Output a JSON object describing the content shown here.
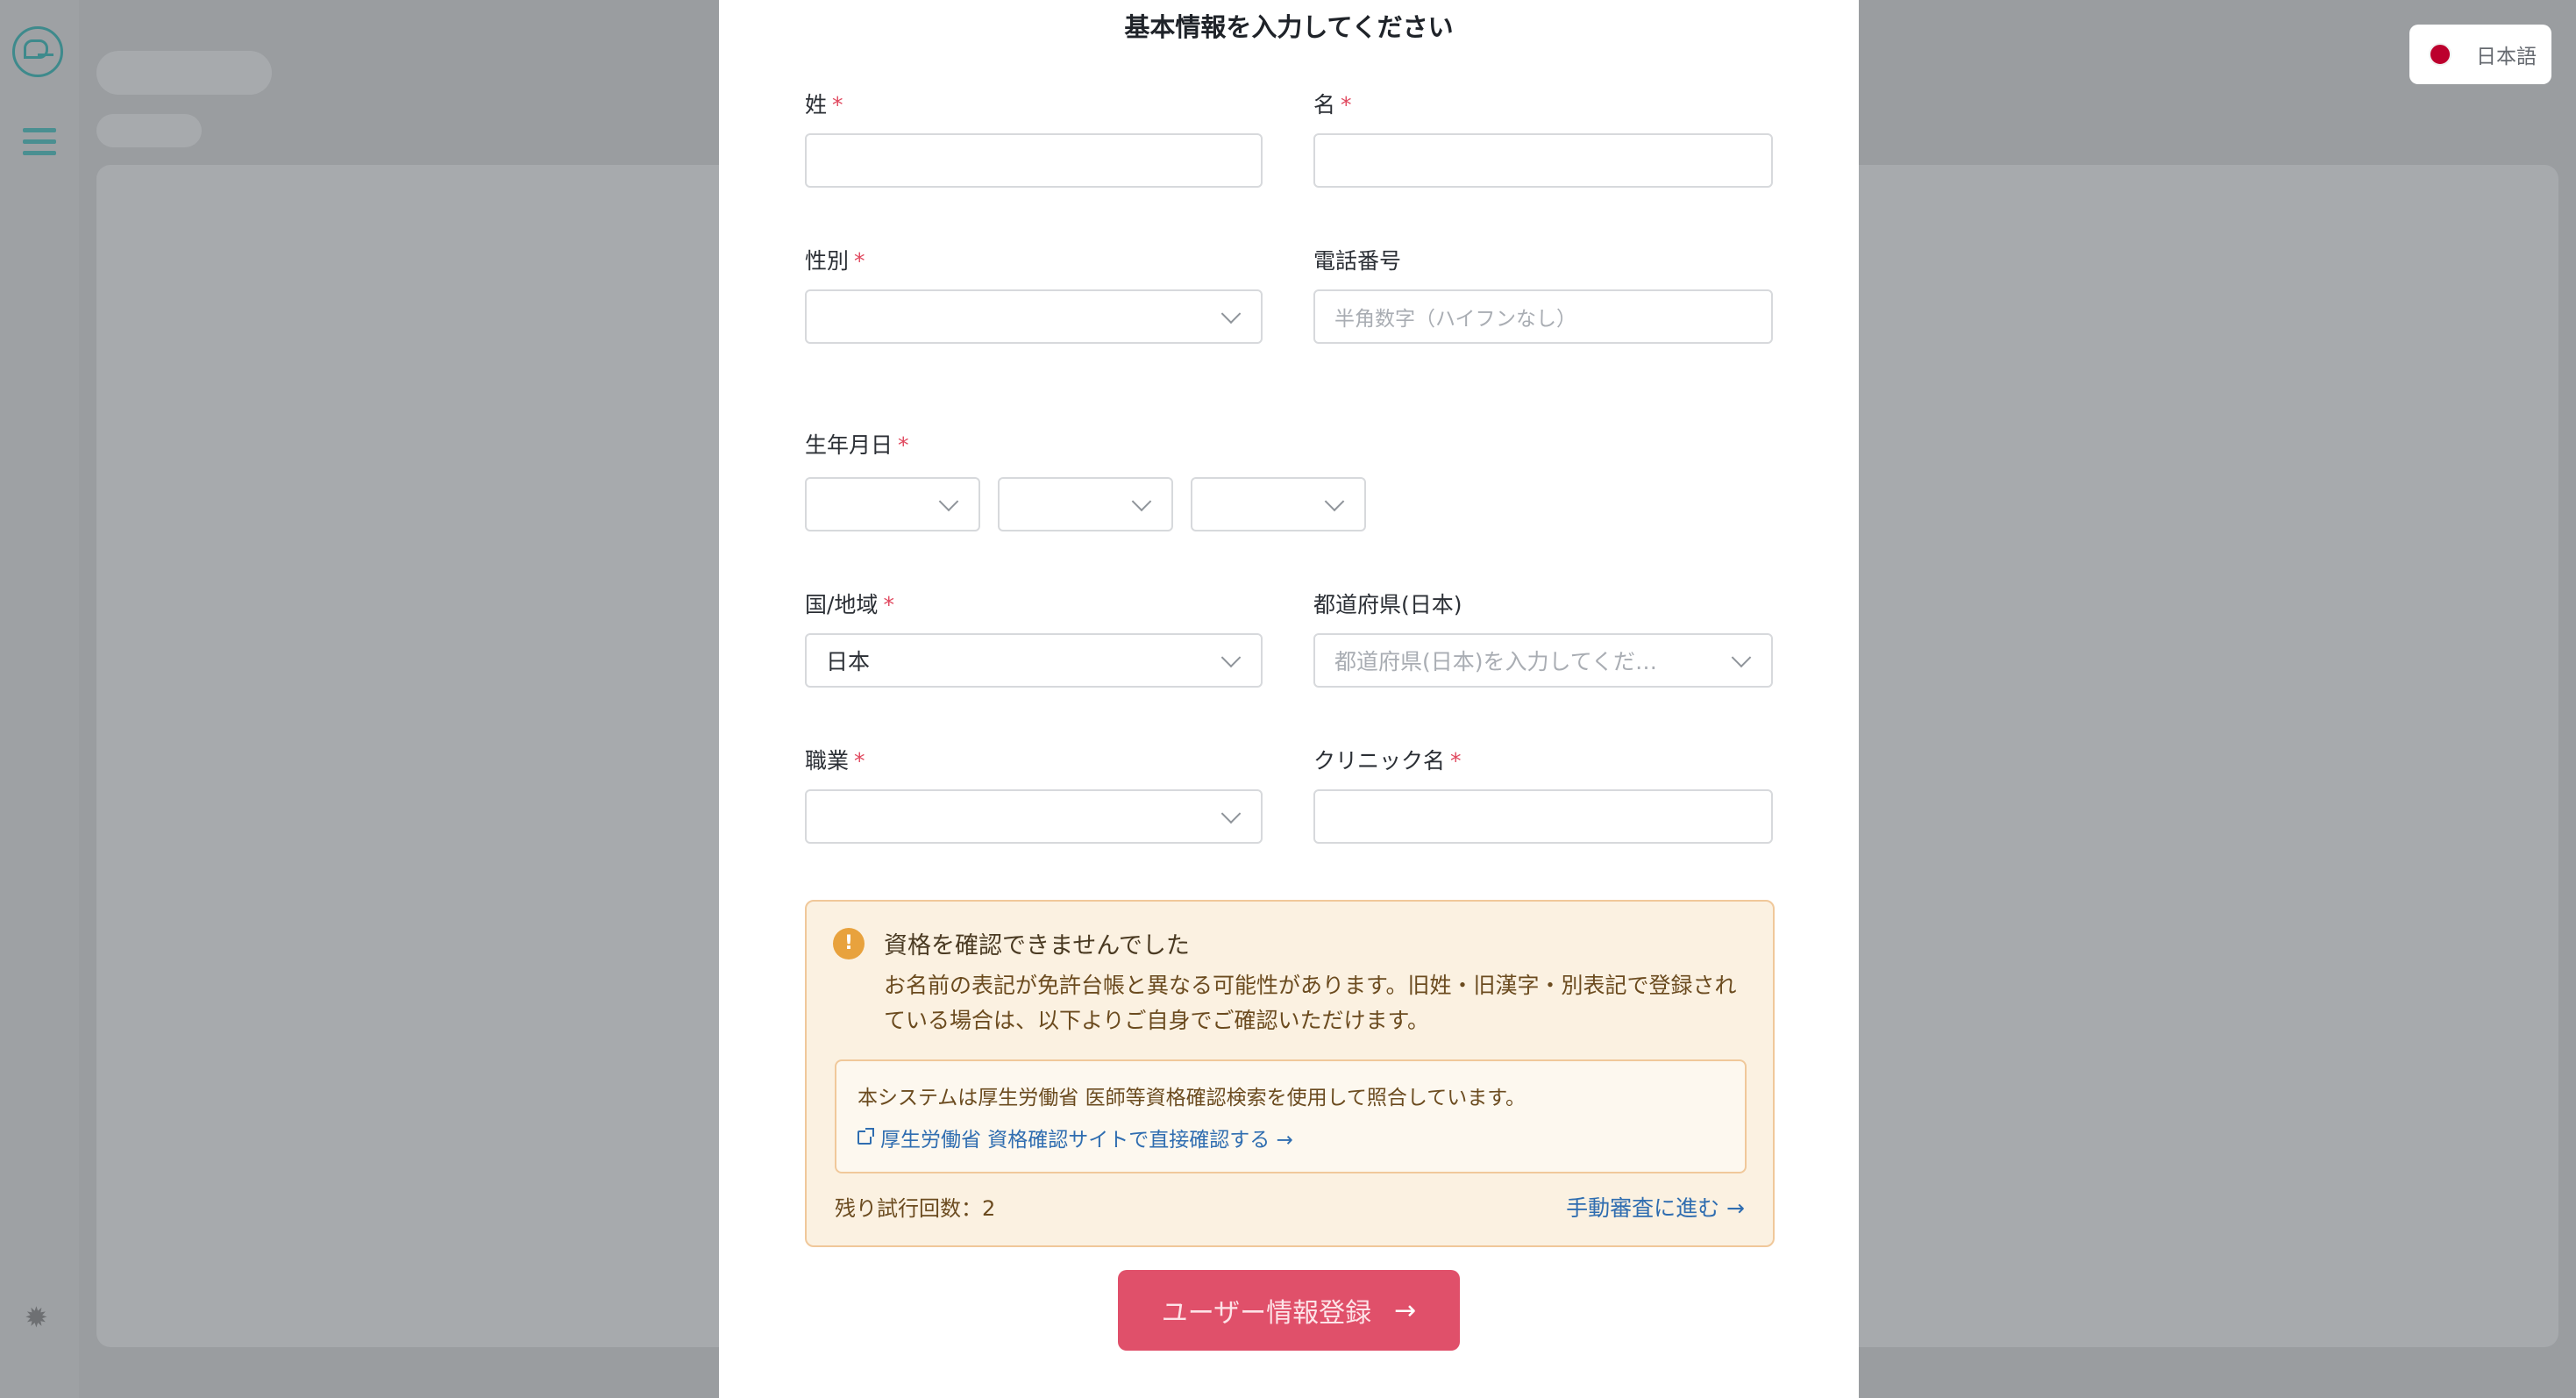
{
  "language": {
    "label": "日本語"
  },
  "modal": {
    "title": "基本情報を入力してください",
    "fields": {
      "last_name": {
        "label": "姓",
        "required": "*",
        "value": ""
      },
      "first_name": {
        "label": "名",
        "required": "*",
        "value": ""
      },
      "gender": {
        "label": "性別",
        "required": "*",
        "value": ""
      },
      "phone": {
        "label": "電話番号",
        "placeholder": "半角数字（ハイフンなし）"
      },
      "birthdate": {
        "label": "生年月日",
        "required": "*",
        "year": "",
        "month": "",
        "day": ""
      },
      "country": {
        "label": "国/地域",
        "required": "*",
        "value": "日本"
      },
      "prefecture": {
        "label": "都道府県(日本)",
        "placeholder": "都道府県(日本)を入力してくだ…"
      },
      "occupation": {
        "label": "職業",
        "required": "*",
        "value": ""
      },
      "clinic": {
        "label": "クリニック名",
        "required": "*",
        "value": ""
      }
    },
    "warning": {
      "icon": "!",
      "title": "資格を確認できませんでした",
      "body": "お名前の表記が免許台帳と異なる可能性があります。旧姓・旧漢字・別表記で登録されている場合は、以下よりご自身でご確認いただけます。",
      "info_text": "本システムは厚生労働省 医師等資格確認検索を使用して照合しています。",
      "info_link": "厚生労働省 資格確認サイトで直接確認する →",
      "attempts": "残り試行回数：2",
      "manual_link": "手動審査に進む →"
    },
    "submit_label": "ユーザー情報登録"
  }
}
